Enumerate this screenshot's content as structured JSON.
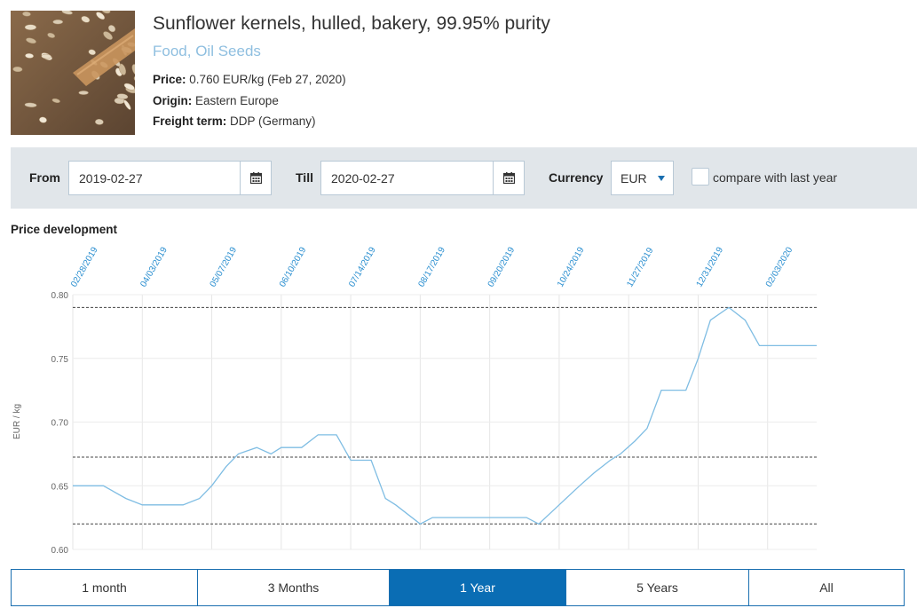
{
  "product": {
    "title": "Sunflower kernels, hulled, bakery, 99.95% purity",
    "category": "Food, Oil Seeds",
    "price_label": "Price:",
    "price_value": "0.760 EUR/kg (Feb 27, 2020)",
    "origin_label": "Origin:",
    "origin_value": "Eastern Europe",
    "freight_label": "Freight term:",
    "freight_value": "DDP (Germany)"
  },
  "filters": {
    "from_label": "From",
    "from_value": "2019-02-27",
    "till_label": "Till",
    "till_value": "2020-02-27",
    "currency_label": "Currency",
    "currency_value": "EUR",
    "compare_label": "compare with last year",
    "compare_checked": false
  },
  "section_title": "Price development",
  "chart_data": {
    "type": "line",
    "ylabel": "EUR / kg",
    "ylim": [
      0.6,
      0.8
    ],
    "y_ticks": [
      "0.80",
      "0.75",
      "0.70",
      "0.65",
      "0.60"
    ],
    "x_tick_labels": [
      "02/28/2019",
      "04/03/2019",
      "05/07/2019",
      "06/10/2019",
      "07/14/2019",
      "08/17/2019",
      "09/20/2019",
      "10/24/2019",
      "11/27/2019",
      "12/31/2019",
      "02/03/2020"
    ],
    "series_color": "#7fbde3",
    "reference_lines": [
      0.79,
      0.6725,
      0.62
    ],
    "x": [
      "2019-02-28",
      "2019-03-15",
      "2019-03-26",
      "2019-04-03",
      "2019-04-23",
      "2019-05-01",
      "2019-05-07",
      "2019-05-14",
      "2019-05-20",
      "2019-05-29",
      "2019-06-05",
      "2019-06-10",
      "2019-06-20",
      "2019-06-28",
      "2019-07-07",
      "2019-07-14",
      "2019-07-24",
      "2019-07-31",
      "2019-08-05",
      "2019-08-17",
      "2019-08-23",
      "2019-09-08",
      "2019-09-20",
      "2019-10-08",
      "2019-10-14",
      "2019-10-24",
      "2019-11-03",
      "2019-11-10",
      "2019-11-18",
      "2019-11-23",
      "2019-11-30",
      "2019-12-06",
      "2019-12-13",
      "2019-12-25",
      "2019-12-31",
      "2020-01-06",
      "2020-01-15",
      "2020-01-23",
      "2020-01-30",
      "2020-02-03",
      "2020-02-27"
    ],
    "y": [
      0.65,
      0.65,
      0.64,
      0.635,
      0.635,
      0.64,
      0.65,
      0.665,
      0.675,
      0.68,
      0.675,
      0.68,
      0.68,
      0.69,
      0.69,
      0.67,
      0.67,
      0.64,
      0.635,
      0.62,
      0.625,
      0.625,
      0.625,
      0.625,
      0.62,
      0.635,
      0.65,
      0.66,
      0.67,
      0.675,
      0.685,
      0.695,
      0.725,
      0.725,
      0.75,
      0.78,
      0.79,
      0.78,
      0.76,
      0.76,
      0.76
    ]
  },
  "ranges": {
    "items": [
      {
        "label": "1 month"
      },
      {
        "label": "3 Months"
      },
      {
        "label": "1 Year"
      },
      {
        "label": "5 Years"
      },
      {
        "label": "All"
      }
    ],
    "active_index": 2
  }
}
